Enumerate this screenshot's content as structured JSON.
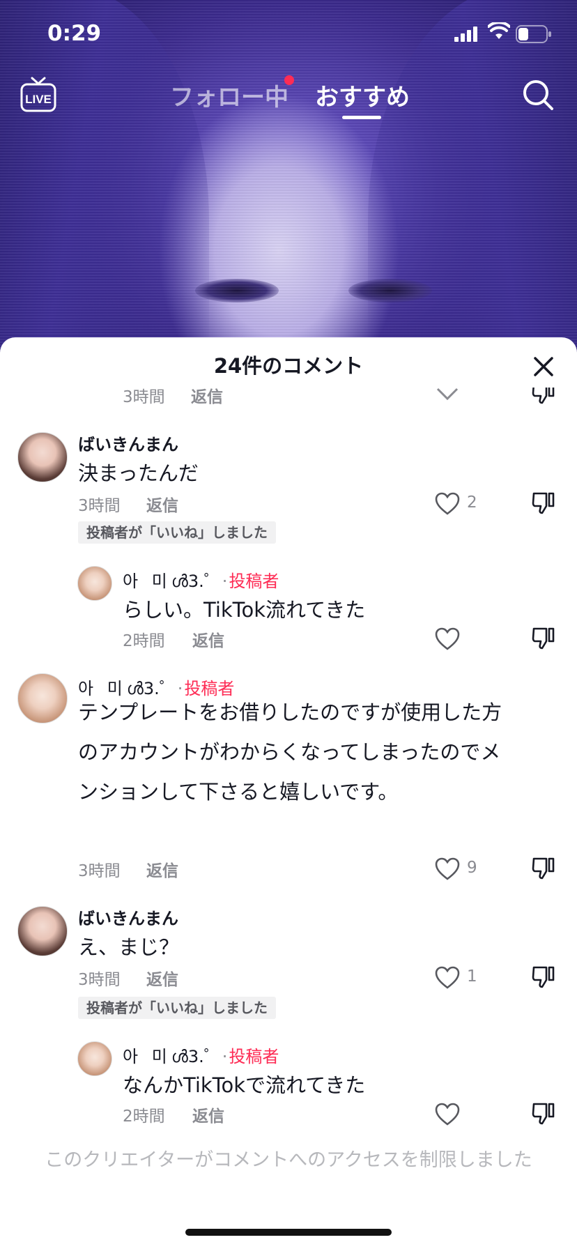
{
  "status_bar": {
    "time": "0:29"
  },
  "nav": {
    "live_label": "LIVE",
    "tab_following": "フォロー中",
    "tab_recommended": "おすすめ"
  },
  "sheet": {
    "title": "24件のコメント",
    "ghost": {
      "time": "3時間",
      "reply": "返信"
    },
    "comments": [
      {
        "user": "ばいきんまん",
        "text": "決まったんだ",
        "time": "3時間",
        "reply": "返信",
        "likes": "2",
        "badge": "投稿者が「いいね」しました"
      },
      {
        "user": "아 미",
        "user_suffix": "ൾ3.゜",
        "author_label": "投稿者",
        "text": "らしい。TikTok流れてきた",
        "time": "2時間",
        "reply": "返信"
      },
      {
        "user": "아 미",
        "user_suffix": "ൾ3.゜",
        "author_label": "投稿者",
        "text": "テンプレートをお借りしたのですが使用した方のアカウントがわからくなってしまったのでメンションして下さると嬉しいです。",
        "time": "3時間",
        "reply": "返信",
        "likes": "9"
      },
      {
        "user": "ばいきんまん",
        "text": "え、まじ？",
        "time": "3時間",
        "reply": "返信",
        "likes": "1",
        "badge": "投稿者が「いいね」しました"
      },
      {
        "user": "아 미",
        "user_suffix": "ൾ3.゜",
        "author_label": "投稿者",
        "text": "なんかTikTokで流れてきた",
        "time": "2時間",
        "reply": "返信"
      }
    ],
    "restricted_notice": "このクリエイターがコメントへのアクセスを制限しました"
  },
  "colors": {
    "accent": "#fe2c55",
    "text": "#161823",
    "muted": "#8a8b91"
  },
  "icons": [
    "live-icon",
    "search-icon",
    "close-icon",
    "heart-icon",
    "dislike-icon",
    "chevron-down-icon"
  ]
}
